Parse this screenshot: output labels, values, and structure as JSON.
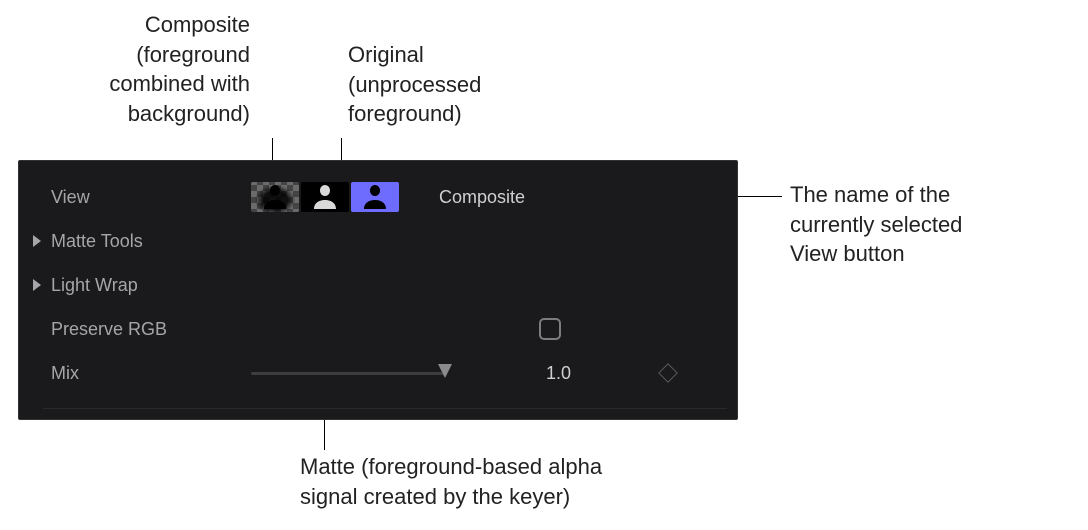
{
  "callouts": {
    "composite": "Composite\n(foreground\ncombined with\nbackground)",
    "original": "Original\n(unprocessed\nforeground)",
    "view_name_desc": "The name of the\ncurrently selected\nView button",
    "matte": "Matte (foreground-based alpha\nsignal created by the keyer)"
  },
  "panel": {
    "view_label": "View",
    "matte_tools_label": "Matte Tools",
    "light_wrap_label": "Light Wrap",
    "preserve_rgb_label": "Preserve RGB",
    "mix_label": "Mix",
    "selected_view_name": "Composite",
    "mix_value": "1.0"
  }
}
